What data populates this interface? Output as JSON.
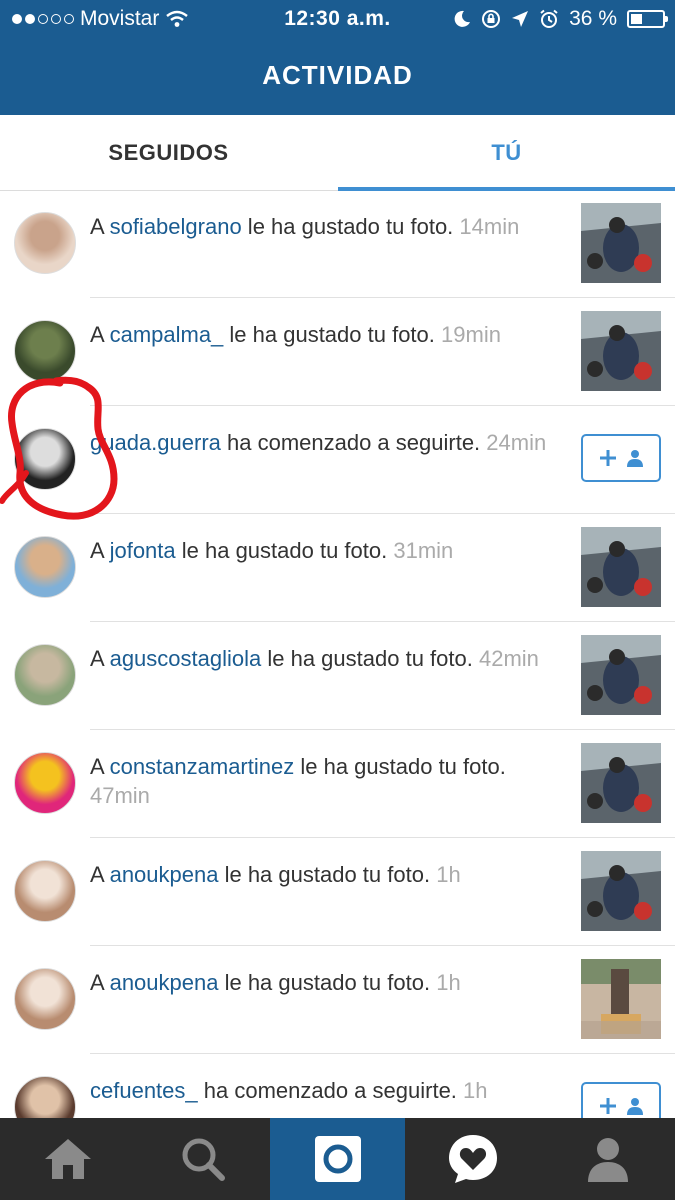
{
  "status_bar": {
    "carrier": "Movistar",
    "time": "12:30 a.m.",
    "battery": "36 %",
    "battery_level": 0.36,
    "signal_dots_filled": 2,
    "signal_dots_total": 5
  },
  "header": {
    "title": "ACTIVIDAD"
  },
  "tabs": {
    "seguidos": "SEGUIDOS",
    "tu": "TÚ",
    "active": "tu"
  },
  "colors": {
    "brand_blue": "#1b5c91",
    "accent_blue": "#3f8fd2",
    "annotation_red": "#e3161c",
    "nav_dark": "#2b2b2b"
  },
  "activity": [
    {
      "prefix": "A ",
      "user": "sofiabelgrano",
      "action": " le ha gustado tu foto.",
      "time": "14min",
      "right": "thumb"
    },
    {
      "prefix": "A ",
      "user": "campalma_",
      "action": " le ha gustado tu foto.",
      "time": "19min",
      "right": "thumb"
    },
    {
      "prefix": "",
      "user": "guada.guerra",
      "action": " ha comenzado a seguirte.",
      "time": "24min",
      "right": "follow"
    },
    {
      "prefix": "A ",
      "user": "jofonta",
      "action": " le ha gustado tu foto.",
      "time": "31min",
      "right": "thumb"
    },
    {
      "prefix": "A ",
      "user": "aguscostagliola",
      "action": " le ha gustado tu foto.",
      "time": "42min",
      "right": "thumb"
    },
    {
      "prefix": "A ",
      "user": "constanzamartinez",
      "action": " le ha gustado tu foto.",
      "time": "47min",
      "right": "thumb"
    },
    {
      "prefix": "A ",
      "user": "anoukpena",
      "action": " le ha gustado tu foto.",
      "time": "1h",
      "right": "thumb"
    },
    {
      "prefix": "A ",
      "user": "anoukpena",
      "action": " le ha gustado tu foto.",
      "time": "1h",
      "right": "thumb2"
    },
    {
      "prefix": "",
      "user": "cefuentes_",
      "action": " ha comenzado a seguirte.",
      "time": "1h",
      "right": "follow"
    }
  ],
  "nav": [
    {
      "icon": "home-icon"
    },
    {
      "icon": "search-icon"
    },
    {
      "icon": "camera-icon"
    },
    {
      "icon": "activity-heart-icon"
    },
    {
      "icon": "profile-icon"
    }
  ]
}
